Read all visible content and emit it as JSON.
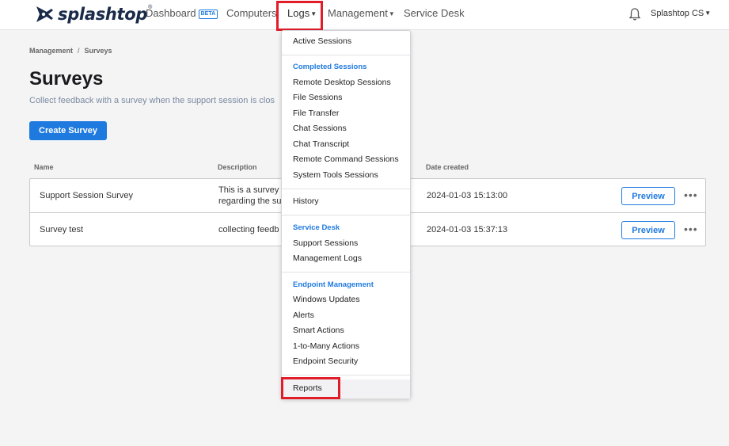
{
  "nav": {
    "brand": "splashtop",
    "dashboard": "Dashboard",
    "beta_badge": "BETA",
    "computers": "Computers",
    "logs": "Logs",
    "management": "Management",
    "service_desk": "Service Desk",
    "account": "Splashtop CS"
  },
  "page": {
    "breadcrumb_root": "Management",
    "breadcrumb_current": "Surveys",
    "title": "Surveys",
    "subtitle": "Collect feedback with a survey when the support session is clos",
    "create_button": "Create Survey"
  },
  "table": {
    "headers": {
      "name": "Name",
      "description": "Description",
      "date": "Date created"
    },
    "rows": [
      {
        "name": "Support Session Survey",
        "description_line1": "This is a survey",
        "description_line2": "regarding the su",
        "date": "2024-01-03 15:13:00",
        "action": "Preview"
      },
      {
        "name": "Survey test",
        "description_line1": "collecting feedb",
        "date": "2024-01-03 15:37:13",
        "action": "Preview"
      }
    ]
  },
  "logs_menu": {
    "active_sessions": "Active Sessions",
    "completed_header": "Completed Sessions",
    "completed_items": [
      "Remote Desktop Sessions",
      "File Sessions",
      "File Transfer",
      "Chat Sessions",
      "Chat Transcript",
      "Remote Command Sessions",
      "System Tools Sessions"
    ],
    "history": "History",
    "service_desk_header": "Service Desk",
    "service_desk_items": [
      "Support Sessions",
      "Management Logs"
    ],
    "endpoint_header": "Endpoint Management",
    "endpoint_items": [
      "Windows Updates",
      "Alerts",
      "Smart Actions",
      "1-to-Many Actions",
      "Endpoint Security"
    ],
    "reports": "Reports"
  },
  "colors": {
    "accent": "#1f7ae0",
    "highlight": "#e21d2a",
    "brand_dark": "#1a2b49"
  }
}
